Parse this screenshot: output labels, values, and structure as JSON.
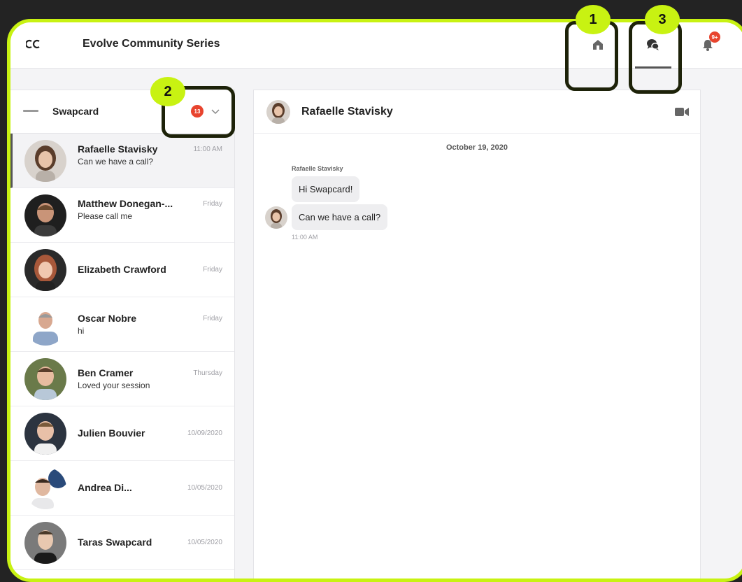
{
  "app": {
    "title": "Evolve Community Series",
    "accent": "#c8f212"
  },
  "nav": {
    "icons": [
      "home-icon",
      "chat-icon",
      "bell-icon"
    ],
    "notification_count": "9+"
  },
  "sidebar": {
    "org_name": "Swapcard",
    "unread_count": "13",
    "conversations": [
      {
        "name": "Rafaelle Stavisky",
        "preview": "Can we have a call?",
        "time": "11:00 AM"
      },
      {
        "name": "Matthew Donegan-...",
        "preview": "Please call me",
        "time": "Friday"
      },
      {
        "name": "Elizabeth Crawford",
        "preview": "",
        "time": "Friday"
      },
      {
        "name": "Oscar Nobre",
        "preview": "hi",
        "time": "Friday"
      },
      {
        "name": "Ben Cramer",
        "preview": "Loved your session",
        "time": "Thursday"
      },
      {
        "name": "Julien Bouvier",
        "preview": "",
        "time": "10/09/2020"
      },
      {
        "name": "Andrea Di...",
        "preview": "",
        "time": "10/05/2020"
      },
      {
        "name": "Taras Swapcard",
        "preview": "",
        "time": "10/05/2020"
      }
    ]
  },
  "chat": {
    "contact_name": "Rafaelle Stavisky",
    "date": "October 19, 2020",
    "sender": "Rafaelle Stavisky",
    "messages": [
      "Hi Swapcard!",
      "Can we have a call?"
    ],
    "time": "11:00 AM"
  },
  "callouts": [
    "1",
    "2",
    "3"
  ]
}
